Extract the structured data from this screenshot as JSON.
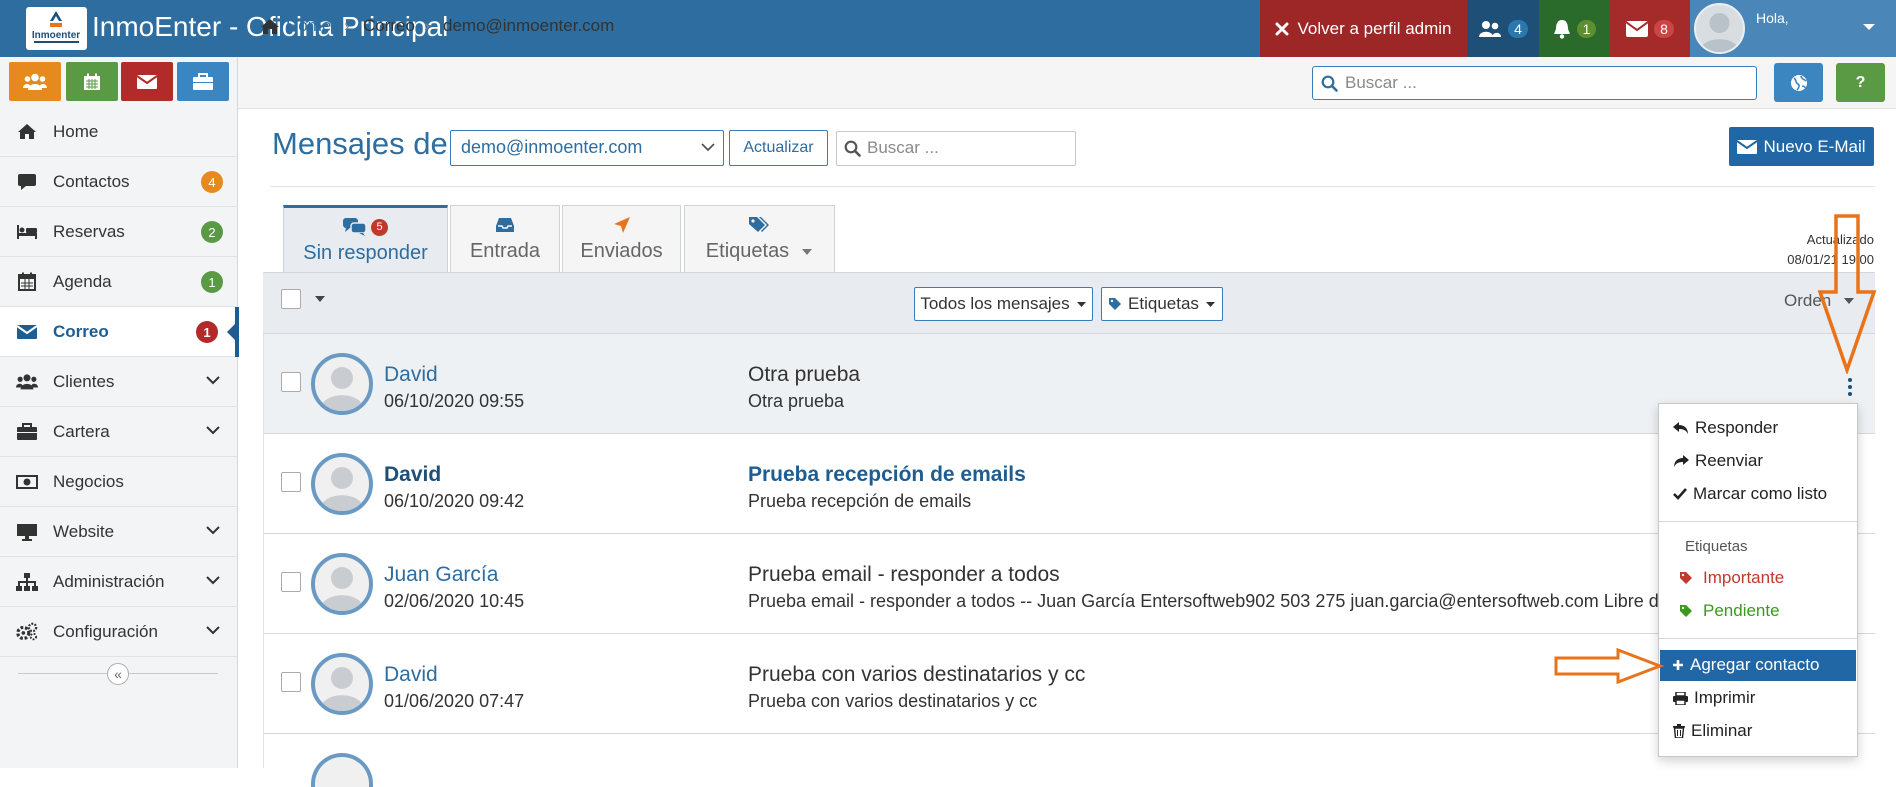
{
  "app": {
    "title": "InmoEnter - Oficina Principal",
    "logo_text": "Inmoenter"
  },
  "topbar": {
    "admin_button": "Volver a perfil admin",
    "counters": {
      "users": "4",
      "notifications": "1",
      "messages": "8"
    },
    "user_greeting": "Hola,"
  },
  "quick_buttons": [
    "users-icon",
    "calendar-icon",
    "envelope-icon",
    "briefcase-icon"
  ],
  "sidebar": {
    "items": [
      {
        "label": "Home",
        "icon": "home-icon"
      },
      {
        "label": "Contactos",
        "icon": "comment-icon",
        "badge": "4",
        "badge_color": "#e68a1e"
      },
      {
        "label": "Reservas",
        "icon": "bed-icon",
        "badge": "2",
        "badge_color": "#5a9a45"
      },
      {
        "label": "Agenda",
        "icon": "calendar-icon",
        "badge": "1",
        "badge_color": "#5a9a45"
      },
      {
        "label": "Correo",
        "icon": "envelope-icon",
        "badge": "1",
        "badge_color": "#b22a2a",
        "active": true
      },
      {
        "label": "Clientes",
        "icon": "users-icon",
        "expandable": true
      },
      {
        "label": "Cartera",
        "icon": "briefcase-icon",
        "expandable": true
      },
      {
        "label": "Negocios",
        "icon": "money-icon"
      },
      {
        "label": "Website",
        "icon": "desktop-icon",
        "expandable": true
      },
      {
        "label": "Administración",
        "icon": "sitemap-icon",
        "expandable": true
      },
      {
        "label": "Configuración",
        "icon": "cogs-icon",
        "expandable": true
      }
    ],
    "collapse_glyph": "«"
  },
  "breadcrumb": {
    "home": "Home",
    "section": "Correo",
    "current": "demo@inmoenter.com"
  },
  "top_search": {
    "placeholder": "Buscar ..."
  },
  "main": {
    "title": "Mensajes de",
    "account": "demo@inmoenter.com",
    "update_button": "Actualizar",
    "search_placeholder": "Buscar ...",
    "new_mail_button": "Nuevo E-Mail",
    "updated_label": "Actualizado",
    "updated_time": "08/01/21 19:00"
  },
  "tabs": [
    {
      "label": "Sin responder",
      "icon": "comments-icon",
      "badge": "5",
      "active": true
    },
    {
      "label": "Entrada",
      "icon": "inbox-icon"
    },
    {
      "label": "Enviados",
      "icon": "send-icon"
    },
    {
      "label": "Etiquetas",
      "icon": "tags-icon",
      "dropdown": true
    }
  ],
  "toolbar": {
    "filter_all": "Todos los mensajes",
    "filter_tags": "Etiquetas",
    "order_label": "Orden"
  },
  "messages": [
    {
      "from": "David",
      "date": "06/10/2020 09:55",
      "subject": "Otra prueba",
      "preview": "Otra prueba",
      "unread": false,
      "hover": true
    },
    {
      "from": "David",
      "date": "06/10/2020 09:42",
      "subject": "Prueba recepción de emails",
      "preview": "Prueba recepción de emails",
      "unread": true
    },
    {
      "from": "Juan García",
      "date": "02/06/2020 10:45",
      "subject": "Prueba email - responder a todos",
      "preview": "Prueba email - responder a todos -- Juan García Entersoftweb902 503 275 juan.garcia@entersoftweb.com Libre de virus. www.avast.com",
      "unread": false
    },
    {
      "from": "David",
      "date": "01/06/2020 07:47",
      "subject": "Prueba con varios destinatarios y cc",
      "preview": "Prueba con varios destinatarios y cc",
      "unread": false
    }
  ],
  "context_menu": {
    "reply": "Responder",
    "forward": "Reenviar",
    "mark_done": "Marcar como listo",
    "tags_header": "Etiquetas",
    "tag_important": "Importante",
    "tag_important_color": "#c0392b",
    "tag_pending": "Pendiente",
    "tag_pending_color": "#3a9a1a",
    "add_contact": "Agregar contacto",
    "print": "Imprimir",
    "delete": "Eliminar"
  },
  "colors": {
    "primary": "#2d6d9f",
    "admin_red": "#9d2626",
    "annotation_orange": "#e8731a"
  }
}
